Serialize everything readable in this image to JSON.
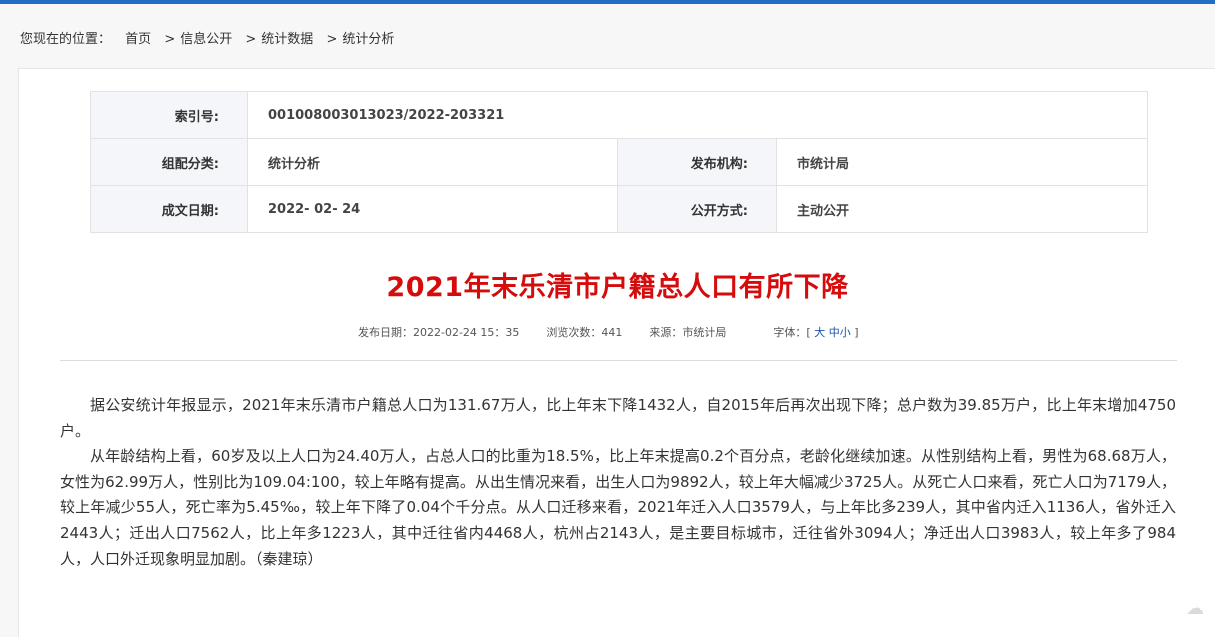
{
  "breadcrumb": {
    "prefix": "您现在的位置：",
    "items": [
      "首页",
      "信息公开",
      "统计数据",
      "统计分析"
    ],
    "separator": ">"
  },
  "meta_table": {
    "index_label": "索引号:",
    "index_value": "001008003013023/2022-203321",
    "category_label": "组配分类:",
    "category_value": "统计分析",
    "publisher_label": "发布机构:",
    "publisher_value": "市统计局",
    "date_label": "成文日期:",
    "date_value": "2022- 02- 24",
    "disclosure_label": "公开方式:",
    "disclosure_value": "主动公开"
  },
  "article": {
    "title": "2021年末乐清市户籍总人口有所下降",
    "pub_date_label": "发布日期：",
    "pub_date": "2022-02-24 15：35",
    "views_label": "浏览次数：",
    "views": "441",
    "source_label": "来源：",
    "source": "市统计局",
    "font_label": "字体：",
    "font_open": "[",
    "font_large": "大",
    "font_medium": "中",
    "font_small": "小",
    "font_close": "]",
    "paragraphs": [
      "据公安统计年报显示，2021年末乐清市户籍总人口为131.67万人，比上年末下降1432人，自2015年后再次出现下降；总户数为39.85万户，比上年末增加4750户。",
      "从年龄结构上看，60岁及以上人口为24.40万人，占总人口的比重为18.5%，比上年末提高0.2个百分点，老龄化继续加速。从性别结构上看，男性为68.68万人，女性为62.99万人，性别比为109.04:100，较上年略有提高。从出生情况来看，出生人口为9892人，较上年大幅减少3725人。从死亡人口来看，死亡人口为7179人，较上年减少55人，死亡率为5.45‰，较上年下降了0.04个千分点。从人口迁移来看，2021年迁入人口3579人，与上年比多239人，其中省内迁入1136人，省外迁入2443人；迁出人口7562人，比上年多1223人，其中迁往省内4468人，杭州占2143人，是主要目标城市，迁往省外3094人；净迁出人口3983人，较上年多了984人，人口外迁现象明显加剧。（秦建琼）"
    ]
  },
  "colors": {
    "accent": "#1f6fc5",
    "title": "#d60b0b",
    "link": "#1a4fa8"
  }
}
